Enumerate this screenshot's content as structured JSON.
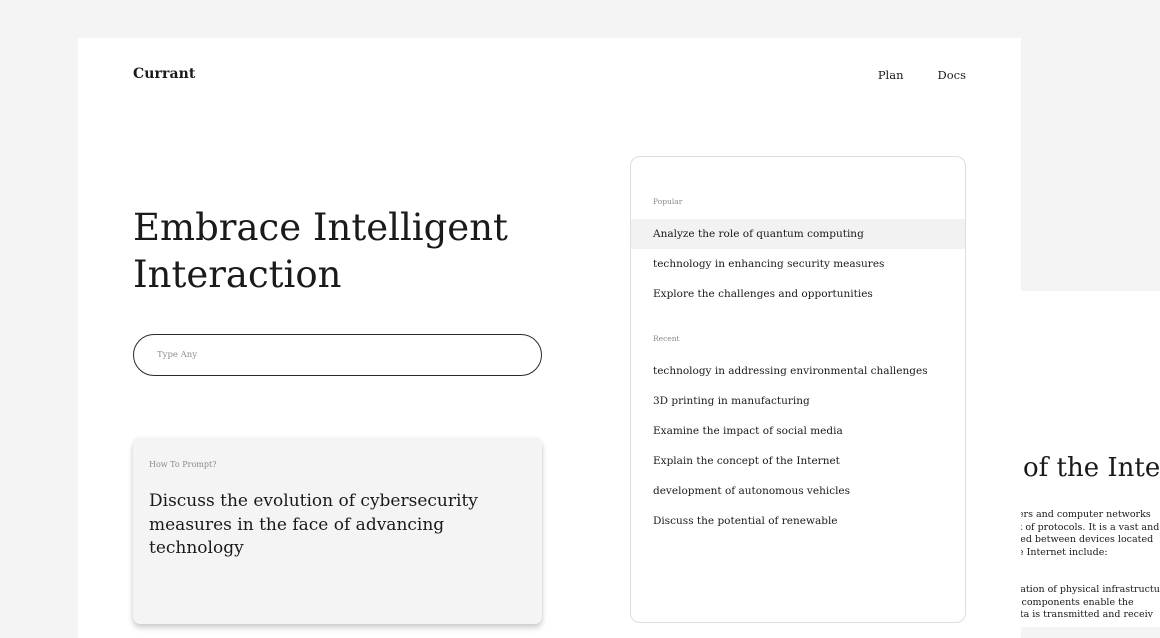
{
  "app": {
    "brand": "Currant"
  },
  "nav": {
    "items": [
      "Plan",
      "Docs"
    ]
  },
  "hero": {
    "headline": "Embrace Intelligent Interaction"
  },
  "search": {
    "placeholder": "Type Any",
    "value": ""
  },
  "prompt_card": {
    "label": "How To Prompt?",
    "text": "Discuss the evolution of cybersecurity measures in the face of advancing technology"
  },
  "suggestions": {
    "popular_label": "Popular",
    "popular": [
      "Analyze the role of quantum computing",
      "technology in enhancing security measures",
      "Explore the challenges and opportunities"
    ],
    "recent_label": "Recent",
    "recent": [
      "technology in addressing environmental challenges",
      "3D printing in manufacturing",
      "Examine the impact of social media",
      "Explain the concept of the Internet",
      "development of autonomous vehicles",
      "Discuss the potential of renewable"
    ]
  },
  "doc_peek": {
    "title": "of the Inter",
    "paragraph_1": [
      "uters and computer networks",
      "set of protocols. It is a vast and",
      "nged between devices located",
      "the Internet include:"
    ],
    "paragraph_2": [
      "ndation of physical infrastructu",
      "se components enable the",
      "data is transmitted and receiv"
    ]
  }
}
